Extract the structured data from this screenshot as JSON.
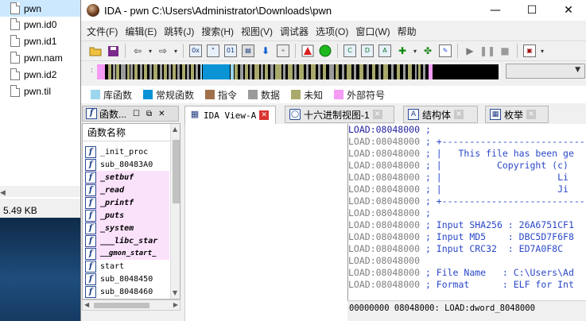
{
  "explorer": {
    "files": [
      "pwn",
      "pwn.id0",
      "pwn.id1",
      "pwn.nam",
      "pwn.id2",
      "pwn.til"
    ],
    "selected_index": 0,
    "size_label": "5.49 KB"
  },
  "window": {
    "title": "IDA - pwn C:\\Users\\Administrator\\Downloads\\pwn",
    "minimize": "—",
    "maximize": "☐",
    "close": "✕"
  },
  "menu": [
    "文件(F)",
    "编辑(E)",
    "跳转(J)",
    "搜索(H)",
    "视图(V)",
    "调试器",
    "选项(O)",
    "窗口(W)",
    "帮助"
  ],
  "toolbar": {
    "icons": [
      "open-folder-icon",
      "save-icon",
      "back-arrow-icon",
      "forward-arrow-icon",
      "hex-view-icon",
      "text-view-icon",
      "binary-view-icon",
      "struct-view-icon",
      "jump-down-icon",
      "stack-icon",
      "warning-icon",
      "run-green-icon",
      "code-icon",
      "data-icon",
      "make-array-icon",
      "add-cross-icon",
      "undefine-icon",
      "comment-icon",
      "play-icon",
      "pause-icon",
      "stop-icon",
      "debugger-icon"
    ]
  },
  "legend": [
    {
      "label": "库函数",
      "color": "#9cd5ee"
    },
    {
      "label": "常规函数",
      "color": "#0a94d6"
    },
    {
      "label": "指令",
      "color": "#a0704c"
    },
    {
      "label": "数据",
      "color": "#9b9b9b"
    },
    {
      "label": "未知",
      "color": "#a9a96b"
    },
    {
      "label": "外部符号",
      "color": "#f49bf4"
    }
  ],
  "functions_pane": {
    "title": "函数...",
    "column_header": "函数名称",
    "items": [
      {
        "name": "_init_proc",
        "lib": false
      },
      {
        "name": "sub_80483A0",
        "lib": false
      },
      {
        "name": "_setbuf",
        "lib": true
      },
      {
        "name": "_read",
        "lib": true
      },
      {
        "name": "_printf",
        "lib": true
      },
      {
        "name": "_puts",
        "lib": true
      },
      {
        "name": "_system",
        "lib": true
      },
      {
        "name": "___libc_star",
        "lib": true
      },
      {
        "name": "__gmon_start_",
        "lib": true
      },
      {
        "name": "start",
        "lib": false
      },
      {
        "name": "sub_8048450",
        "lib": false
      },
      {
        "name": "sub_8048460",
        "lib": false
      }
    ]
  },
  "tabs": [
    {
      "label": "IDA View-A",
      "active": true,
      "icon": "ida-view-icon"
    },
    {
      "label": "十六进制视图-1",
      "active": false,
      "icon": "hex-view-icon"
    },
    {
      "label": "结构体",
      "active": false,
      "icon": "struct-icon"
    },
    {
      "label": "枚举",
      "active": false,
      "icon": "enum-icon"
    }
  ],
  "listing": {
    "lines": [
      {
        "addr": "LOAD:08048000",
        "text": " ;",
        "first": true
      },
      {
        "addr": "LOAD:08048000",
        "text": " ; +---------------------------------",
        "first": false
      },
      {
        "addr": "LOAD:08048000",
        "text": " ; |   This file has been ge",
        "first": false
      },
      {
        "addr": "LOAD:08048000",
        "text": " ; |          Copyright (c)",
        "first": false
      },
      {
        "addr": "LOAD:08048000",
        "text": " ; |                     Li",
        "first": false
      },
      {
        "addr": "LOAD:08048000",
        "text": " ; |                     Ji",
        "first": false
      },
      {
        "addr": "LOAD:08048000",
        "text": " ; +---------------------------------",
        "first": false
      },
      {
        "addr": "LOAD:08048000",
        "text": " ;",
        "first": false
      },
      {
        "addr": "LOAD:08048000",
        "text": " ; Input SHA256 : 26A6751CF1",
        "first": false
      },
      {
        "addr": "LOAD:08048000",
        "text": " ; Input MD5    : DBC5D7F6F8",
        "first": false
      },
      {
        "addr": "LOAD:08048000",
        "text": " ; Input CRC32  : ED7A0F8C",
        "first": false
      },
      {
        "addr": "LOAD:08048000",
        "text": "",
        "first": false
      },
      {
        "addr": "LOAD:08048000",
        "text": " ; File Name   : C:\\Users\\Ad",
        "first": false
      },
      {
        "addr": "LOAD:08048000",
        "text": " ; Format      : ELF for Int",
        "first": false
      }
    ],
    "status": "00000000 08048000: LOAD:dword_8048000"
  }
}
